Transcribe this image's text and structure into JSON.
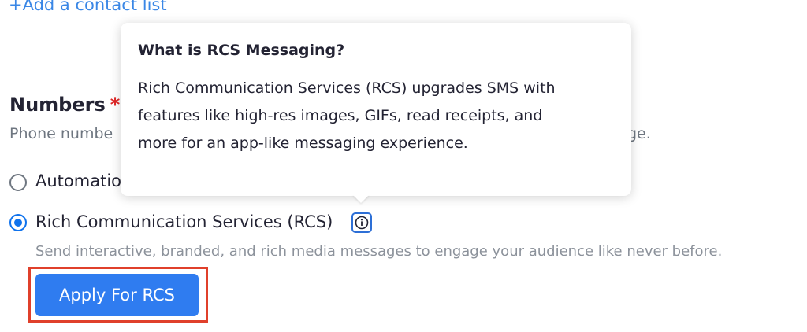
{
  "contacts": {
    "add_link": "+Add a contact list"
  },
  "numbers": {
    "title": "Numbers",
    "required_mark": "*",
    "description_visible": "Phone numbe",
    "description_tail": "ge.",
    "options": [
      {
        "label": "Automatic",
        "label_visible": "Automatio",
        "selected": false
      },
      {
        "label": "Rich Communication Services (RCS)",
        "selected": true,
        "description": "Send interactive, branded, and rich media messages to engage your audience like never before."
      }
    ],
    "apply_button": "Apply For RCS"
  },
  "tooltip": {
    "title": "What is RCS Messaging?",
    "lines": [
      "Rich Communication Services (RCS) upgrades SMS with",
      "features like high-res images, GIFs, read receipts, and",
      "more for an app-like messaging experience."
    ]
  },
  "colors": {
    "link": "#3a87e6",
    "primary": "#2f7cf0",
    "radio_selected": "#0e72ed",
    "required": "#e02828",
    "highlight_outline": "#e0402b"
  },
  "icons": {
    "info": "info-icon"
  }
}
